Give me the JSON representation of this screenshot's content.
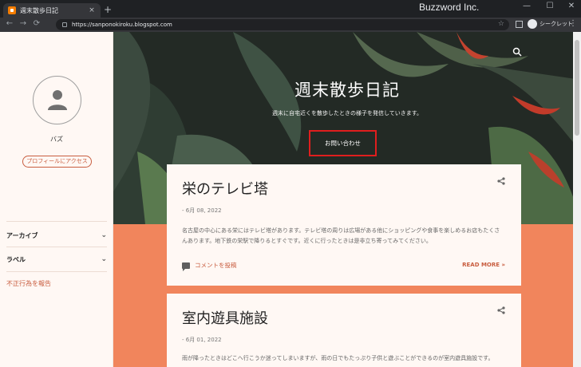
{
  "browser": {
    "tab_title": "週末散歩日記",
    "tab_close": "×",
    "new_tab": "+",
    "brand": "Buzzword Inc.",
    "url": "https://sanponokiroku.blogspot.com",
    "incognito_label": "シークレット",
    "back": "←",
    "forward": "→",
    "reload": "⟳",
    "star": "☆",
    "menu": "⋮",
    "minimize": "—",
    "maximize": "☐",
    "close": "✕"
  },
  "sidebar": {
    "profile_name": "バズ",
    "profile_button": "プロフィールにアクセス",
    "archive_label": "アーカイブ",
    "labels_label": "ラベル",
    "chevron": "⌄",
    "report_link": "不正行為を報告"
  },
  "header": {
    "title": "週末散歩日記",
    "description": "週末に自宅近くを散歩したときの様子を発信していきます。",
    "contact_button": "お問い合わせ"
  },
  "posts": [
    {
      "title": "栄のテレビ塔",
      "date": "- 6月 08, 2022",
      "body": "名古屋の中心にある栄にはテレビ塔があります。テレビ塔の周りは広場がある他にショッピングや食事を楽しめるお店もたくさんあります。地下鉄の栄駅で降りるとすぐです。近くに行ったときは是非立ち寄ってみてください。",
      "comment_label": "コメントを投稿",
      "read_more": "READ MORE »"
    },
    {
      "title": "室内遊具施設",
      "date": "- 6月 01, 2022",
      "body": "雨が降ったときはどこへ行こうか迷ってしまいますが、雨の日でもたっぷり子供と遊ぶことができるのが室内遊具施設です。"
    }
  ],
  "colors": {
    "accent": "#c85d3f",
    "orange_background": "#f1855c",
    "highlight_box": "#e01e1e",
    "card": "#fff8f4"
  }
}
